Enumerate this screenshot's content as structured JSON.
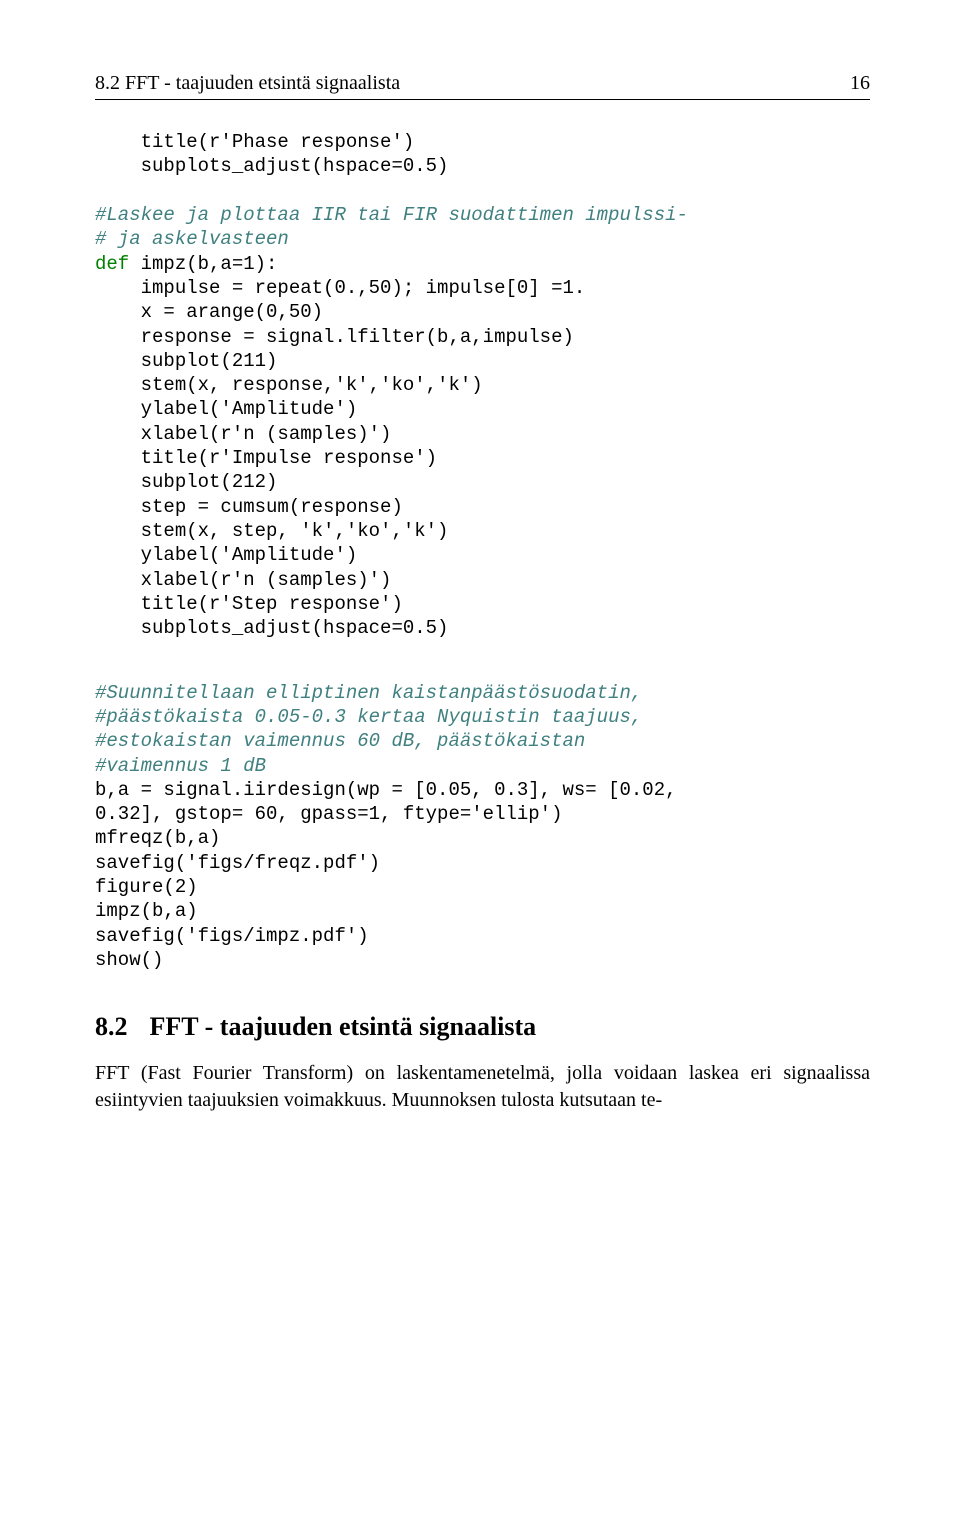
{
  "header": {
    "left": "8.2   FFT - taajuuden etsintä signaalista",
    "right": "16"
  },
  "code1": {
    "l1": "title(r'Phase response')",
    "l2": "subplots_adjust(hspace=0.5)",
    "c1": "#Laskee ja plottaa IIR tai FIR suodattimen impulssi-",
    "c2": "# ja askelvasteen",
    "kw": "def",
    "l3a": " impz(b,a=1):",
    "l4": "impulse = repeat(0.,50); impulse[0] =1.",
    "l5": "x = arange(0,50)",
    "l6": "response = signal.lfilter(b,a,impulse)",
    "l7": "subplot(211)",
    "l8": "stem(x, response,'k','ko','k')",
    "l9": "ylabel('Amplitude')",
    "l10": "xlabel(r'n (samples)')",
    "l11": "title(r'Impulse response')",
    "l12": "subplot(212)",
    "l13": "step = cumsum(response)",
    "l14": "stem(x, step, 'k','ko','k')",
    "l15": "ylabel('Amplitude')",
    "l16": "xlabel(r'n (samples)')",
    "l17": "title(r'Step response')",
    "l18": "subplots_adjust(hspace=0.5)"
  },
  "code2": {
    "c1": "#Suunnitellaan elliptinen kaistanpäästösuodatin,",
    "c2": "#päästökaista 0.05-0.3 kertaa Nyquistin taajuus,",
    "c3": "#estokaistan vaimennus 60 dB, päästökaistan",
    "c4": "#vaimennus 1 dB",
    "l1": "b,a = signal.iirdesign(wp = [0.05, 0.3], ws= [0.02,",
    "l2": "0.32], gstop= 60, gpass=1, ftype='ellip')",
    "l3": "mfreqz(b,a)",
    "l4": "savefig('figs/freqz.pdf')",
    "l5": "figure(2)",
    "l6": "impz(b,a)",
    "l7": "savefig('figs/impz.pdf')",
    "l8": "show()"
  },
  "section": {
    "num": "8.2",
    "title": "FFT - taajuuden etsintä signaalista"
  },
  "para": "FFT (Fast Fourier Transform) on laskentamenetelmä, jolla voidaan laskea eri signaalissa esiintyvien taajuuksien voimakkuus. Muunnoksen tulosta kutsutaan te-"
}
